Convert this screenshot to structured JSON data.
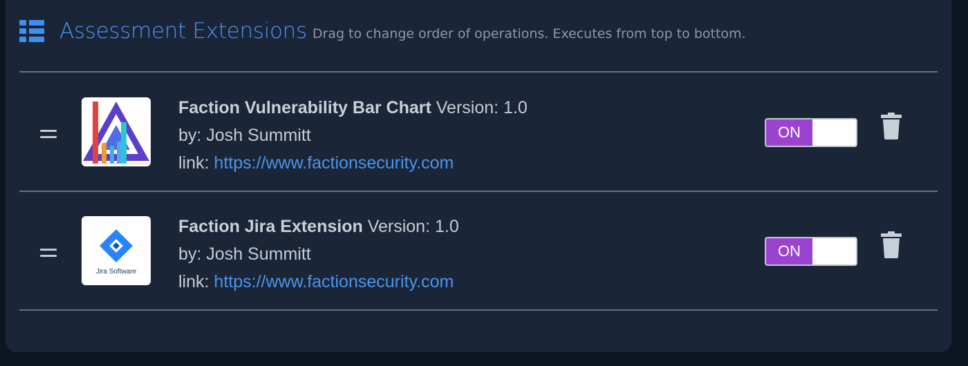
{
  "header": {
    "title": "Assessment Extensions",
    "subtitle": "Drag to change order of operations. Executes from top to bottom."
  },
  "extensions": [
    {
      "name": "Faction Vulnerability Bar Chart",
      "version_label": "Version: 1.0",
      "author": "by: Josh Summitt",
      "link_prefix": "link:",
      "link_url": "https://www.factionsecurity.com",
      "toggle_label": "ON",
      "thumbnail_icon": "bar-chart-logo-icon"
    },
    {
      "name": "Faction Jira Extension",
      "version_label": "Version: 1.0",
      "author": "by: Josh Summitt",
      "link_prefix": "link:",
      "link_url": "https://www.factionsecurity.com",
      "toggle_label": "ON",
      "thumbnail_icon": "jira-logo-icon",
      "thumbnail_caption": "Jira Software"
    }
  ],
  "colors": {
    "accent": "#4a95ea",
    "toggle_on": "#9b43cf",
    "panel_bg": "#1b2538"
  }
}
